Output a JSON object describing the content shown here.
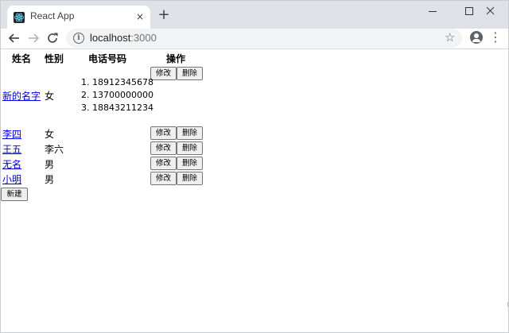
{
  "browser": {
    "tab_title": "React App",
    "tab_close": "×",
    "new_tab": "+",
    "url_host": "localhost",
    "url_port": ":3000",
    "icons": {
      "back": "arrow-left-icon",
      "forward": "arrow-right-icon",
      "reload": "reload-icon",
      "info": "info-icon",
      "star": "star-icon",
      "profile": "profile-icon",
      "menu": "more-vert-icon"
    }
  },
  "table": {
    "headers": {
      "name": "姓名",
      "gender": "性别",
      "phone": "电话号码",
      "actions": "操作"
    },
    "edit_label": "修改",
    "delete_label": "删除",
    "rows": [
      {
        "name": "新的名字",
        "gender": "女",
        "phones": [
          "18912345678",
          "13700000000",
          "18843211234"
        ]
      },
      {
        "name": "李四",
        "gender": "女",
        "phones": []
      },
      {
        "name": "王五",
        "gender": "李六",
        "phones": []
      },
      {
        "name": "无名",
        "gender": "男",
        "phones": []
      },
      {
        "name": "小明",
        "gender": "男",
        "phones": []
      }
    ]
  },
  "new_button_label": "新建",
  "colors": {
    "tabstrip": "#dee1e6",
    "link": "#0000ee",
    "omnibox": "#f1f3f4"
  }
}
